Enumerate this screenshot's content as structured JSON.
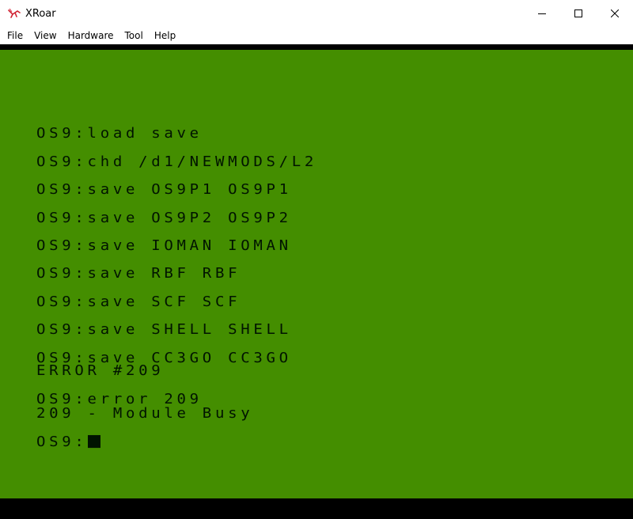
{
  "window": {
    "title": "XRoar",
    "icon": "xroar-app-icon",
    "controls": [
      "minimize-icon",
      "maximize-icon",
      "close-icon"
    ]
  },
  "menu": {
    "items": [
      {
        "label": "File"
      },
      {
        "label": "View"
      },
      {
        "label": "Hardware"
      },
      {
        "label": "Tool"
      },
      {
        "label": "Help"
      }
    ]
  },
  "screen": {
    "background": "#448e00",
    "text_color": "#001400",
    "lines": [
      "OS9:load save",
      "OS9:chd /d1/NEWMODS/L2",
      "OS9:save OS9P1 OS9P1",
      "OS9:save OS9P2 OS9P2",
      "OS9:save IOMAN IOMAN",
      "OS9:save RBF RBF",
      "OS9:save SCF SCF",
      "OS9:save SHELL SHELL",
      "OS9:save CC3GO CC3GO",
      "ERROR #209",
      "OS9:error 209",
      "209 - Module Busy",
      "OS9:"
    ]
  }
}
